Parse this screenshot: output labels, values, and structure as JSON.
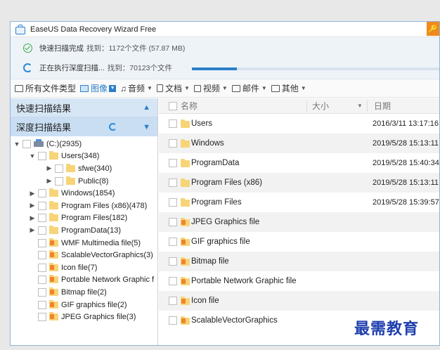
{
  "window": {
    "title": "EaseUS Data Recovery Wizard Free"
  },
  "scan": {
    "quick": {
      "label": "快速扫描完成",
      "found_label": "找到：1172个文件 (57.87 MB)"
    },
    "deep": {
      "label": "正在执行深度扫描...",
      "found_label": "找到：70123个文件",
      "progress": 0.18
    }
  },
  "filters": [
    {
      "label": "所有文件类型",
      "icon": "monitor-icon"
    },
    {
      "label": "图像",
      "icon": "image-icon",
      "active": true
    },
    {
      "label": "音频",
      "icon": "music-icon"
    },
    {
      "label": "文档",
      "icon": "document-icon"
    },
    {
      "label": "视频",
      "icon": "video-icon"
    },
    {
      "label": "邮件",
      "icon": "mail-icon"
    },
    {
      "label": "其他",
      "icon": "folder-icon"
    }
  ],
  "left_panel": {
    "quick_results": "快速扫描结果",
    "deep_results": "深度扫描结果",
    "tree": [
      {
        "label": "(C:)(2935)",
        "type": "drive"
      },
      {
        "label": "Users(348)",
        "type": "folder"
      },
      {
        "label": "sfwe(340)",
        "type": "folder"
      },
      {
        "label": "Public(8)",
        "type": "folder"
      },
      {
        "label": "Windows(1854)",
        "type": "folder"
      },
      {
        "label": "Program Files (x86)(478)",
        "type": "folder"
      },
      {
        "label": "Program Files(182)",
        "type": "folder"
      },
      {
        "label": "ProgramData(13)",
        "type": "folder"
      },
      {
        "label": "WMF Multimedia file(5)",
        "type": "file-folder"
      },
      {
        "label": "ScalableVectorGraphics(3)",
        "type": "file-folder"
      },
      {
        "label": "Icon file(7)",
        "type": "file-folder"
      },
      {
        "label": "Portable Network Graphic f",
        "type": "file-folder"
      },
      {
        "label": "Bitmap file(2)",
        "type": "file-folder"
      },
      {
        "label": "GIF graphics file(2)",
        "type": "file-folder"
      },
      {
        "label": "JPEG Graphics file(3)",
        "type": "file-folder"
      }
    ]
  },
  "columns": {
    "name": "名称",
    "size": "大小",
    "date": "日期"
  },
  "files": [
    {
      "name": "Users",
      "date": "2016/3/11 13:17:16",
      "type": "folder"
    },
    {
      "name": "Windows",
      "date": "2019/5/28 15:13:11",
      "type": "folder"
    },
    {
      "name": "ProgramData",
      "date": "2019/5/28 15:40:34",
      "type": "folder"
    },
    {
      "name": "Program Files (x86)",
      "date": "2019/5/28 15:13:11",
      "type": "folder"
    },
    {
      "name": "Program Files",
      "date": "2019/5/28 15:39:57",
      "type": "folder"
    },
    {
      "name": "JPEG Graphics file",
      "date": "",
      "type": "file-folder"
    },
    {
      "name": "GIF graphics file",
      "date": "",
      "type": "file-folder"
    },
    {
      "name": "Bitmap file",
      "date": "",
      "type": "file-folder"
    },
    {
      "name": "Portable Network Graphic file",
      "date": "",
      "type": "file-folder"
    },
    {
      "name": "Icon file",
      "date": "",
      "type": "file-folder"
    },
    {
      "name": "ScalableVectorGraphics",
      "date": "",
      "type": "file-folder"
    }
  ],
  "watermark": "最需教育"
}
